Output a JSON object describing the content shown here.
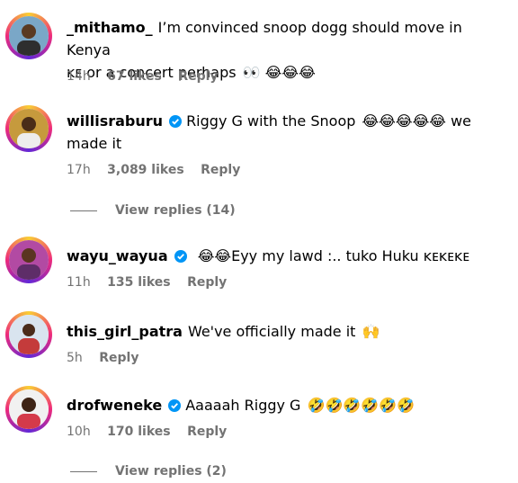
{
  "comments": [
    {
      "username": "_mithamo_",
      "verified": false,
      "text1": "I’m convinced snoop dogg should move in Kenya",
      "text2": "ĸᴇ or a concert perhaps",
      "emoji": "👀 😂😂😂",
      "time": "14h",
      "likes": "67 likes",
      "reply": "Reply"
    },
    {
      "username": "willisraburu",
      "verified": true,
      "text1": "Riggy G with the Snoop",
      "emoji1": "😂😂😂😂😂",
      "text_end": "we",
      "text2": "made it",
      "time": "17h",
      "likes": "3,089 likes",
      "reply": "Reply",
      "view_replies": "View replies (14)"
    },
    {
      "username": "wayu_wayua",
      "verified": true,
      "emoji1": "😂😂",
      "text1": "Eyy my lawd :.. tuko Huku ᴋᴇᴋᴇᴋᴇ",
      "time": "11h",
      "likes": "135 likes",
      "reply": "Reply"
    },
    {
      "username": "this_girl_patra",
      "verified": false,
      "text1": "We've officially made it",
      "emoji1": "🙌",
      "time": "5h",
      "reply": "Reply"
    },
    {
      "username": "drofweneke",
      "verified": true,
      "text1": "Aaaaah Riggy G",
      "emoji1": "🤣🤣🤣🤣🤣🤣",
      "time": "10h",
      "likes": "170 likes",
      "reply": "Reply",
      "view_replies": "View replies (2)"
    }
  ],
  "colors": {
    "verified": "#0095f6",
    "meta": "#737373"
  }
}
